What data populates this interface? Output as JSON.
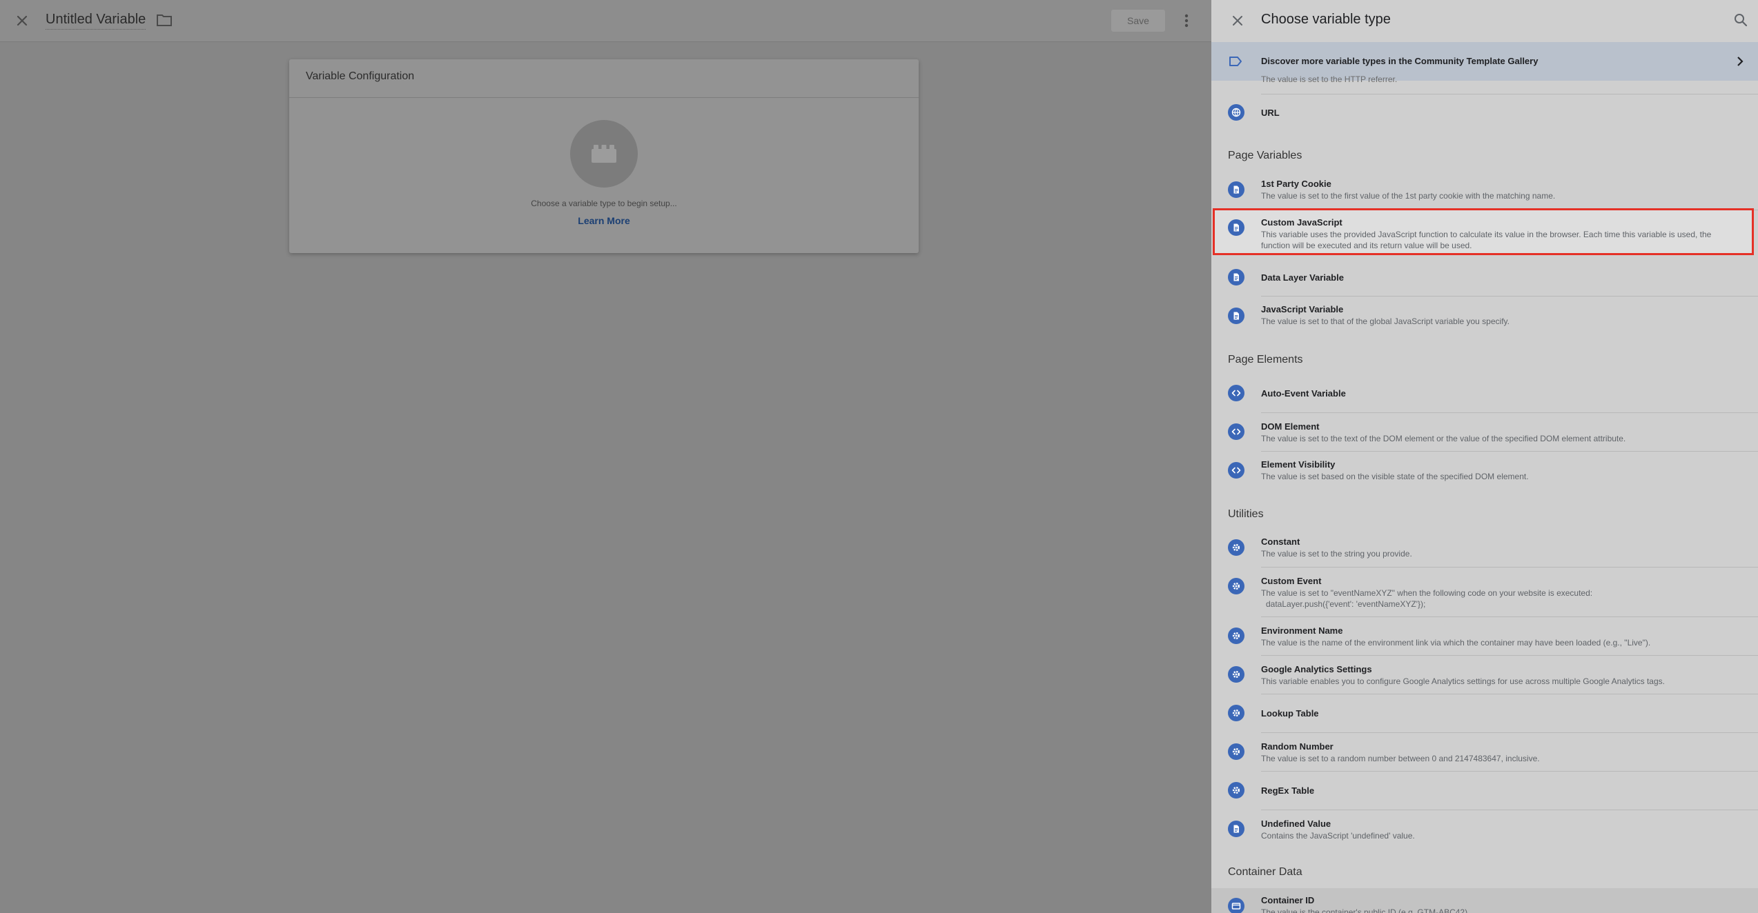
{
  "editor": {
    "title": "Untitled Variable",
    "save_label": "Save",
    "card": {
      "title": "Variable Configuration",
      "hint": "Choose a variable type to begin setup...",
      "learn_more": "Learn More"
    }
  },
  "panel": {
    "title": "Choose variable type",
    "banner": "Discover more variable types in the Community Template Gallery",
    "partial_text": "The value is set to the HTTP referrer.",
    "url_item": "URL",
    "sections": {
      "page_variables": "Page Variables",
      "page_elements": "Page Elements",
      "utilities": "Utilities",
      "container_data": "Container Data"
    },
    "page_variables": [
      {
        "name": "1st Party Cookie",
        "desc": "The value is set to the first value of the 1st party cookie with the matching name."
      },
      {
        "name": "Custom JavaScript",
        "desc": "This variable uses the provided JavaScript function to calculate its value in the browser. Each time this variable is used, the function will be executed and its return value will be used."
      },
      {
        "name": "Data Layer Variable",
        "desc": ""
      },
      {
        "name": "JavaScript Variable",
        "desc": "The value is set to that of the global JavaScript variable you specify."
      }
    ],
    "page_elements": [
      {
        "name": "Auto-Event Variable",
        "desc": ""
      },
      {
        "name": "DOM Element",
        "desc": "The value is set to the text of the DOM element or the value of the specified DOM element attribute."
      },
      {
        "name": "Element Visibility",
        "desc": "The value is set based on the visible state of the specified DOM element."
      }
    ],
    "utilities": [
      {
        "name": "Constant",
        "desc": "The value is set to the string you provide."
      },
      {
        "name": "Custom Event",
        "desc": "The value is set to \"eventNameXYZ\" when the following code on your website is executed:",
        "desc2": "dataLayer.push({'event': 'eventNameXYZ'});"
      },
      {
        "name": "Environment Name",
        "desc": "The value is the name of the environment link via which the container may have been loaded (e.g., \"Live\")."
      },
      {
        "name": "Google Analytics Settings",
        "desc": "This variable enables you to configure Google Analytics settings for use across multiple Google Analytics tags."
      },
      {
        "name": "Lookup Table",
        "desc": ""
      },
      {
        "name": "Random Number",
        "desc": "The value is set to a random number between 0 and 2147483647, inclusive."
      },
      {
        "name": "RegEx Table",
        "desc": ""
      },
      {
        "name": "Undefined Value",
        "desc": "Contains the JavaScript 'undefined' value."
      }
    ],
    "container_data": [
      {
        "name": "Container ID",
        "desc": "The value is the container's public ID (e.g. GTM-ABC42)."
      }
    ]
  },
  "icons": {
    "close": "close-icon",
    "folder": "folder-icon",
    "more": "more-vert-icon",
    "search": "search-icon",
    "tag": "label-icon",
    "chevron": "chevron-right-icon",
    "globe": "globe-icon",
    "document": "document-icon",
    "code": "code-icon",
    "gear": "gear-icon",
    "lego": "lego-block-icon"
  },
  "colors": {
    "accent": "#3b67b7",
    "highlight_border": "#e53026",
    "banner_bg": "#b9c1cc"
  }
}
